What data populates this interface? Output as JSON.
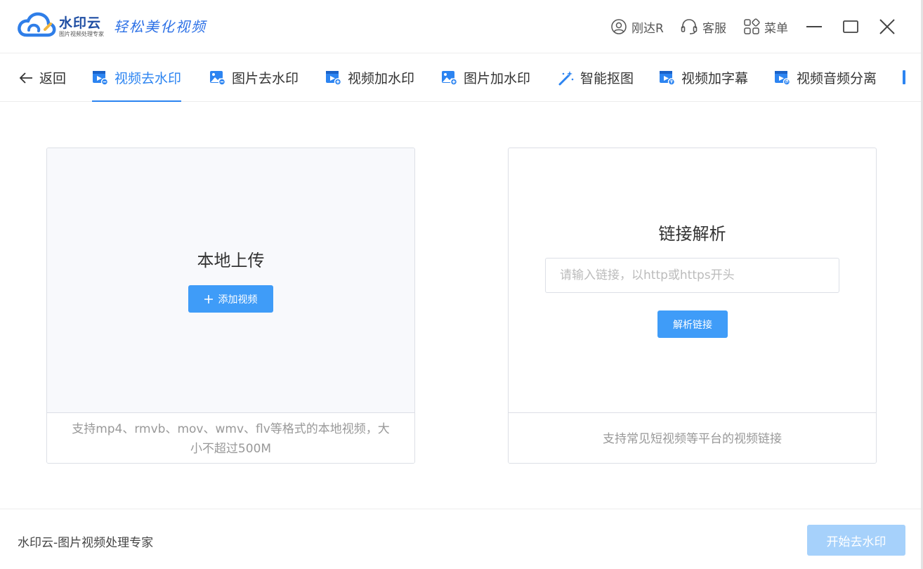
{
  "app": {
    "brand_name": "水印云",
    "brand_sub": "图片视频处理专家",
    "slogan": "轻松美化视频"
  },
  "titlebar": {
    "user_label": "刚达R",
    "support_label": "客服",
    "menu_label": "菜单"
  },
  "tabs": {
    "back_label": "返回",
    "items": [
      {
        "label": "视频去水印",
        "icon": "video-icon"
      },
      {
        "label": "图片去水印",
        "icon": "image-icon"
      },
      {
        "label": "视频加水印",
        "icon": "video-add-icon"
      },
      {
        "label": "图片加水印",
        "icon": "image-add-icon"
      },
      {
        "label": "智能抠图",
        "icon": "magic-wand-icon"
      },
      {
        "label": "视频加字幕",
        "icon": "video-subtitle-icon"
      },
      {
        "label": "视频音频分离",
        "icon": "video-audio-icon"
      }
    ],
    "active_index": 0
  },
  "upload_panel": {
    "title": "本地上传",
    "button_label": "添加视频",
    "hint": "支持mp4、rmvb、mov、wmv、flv等格式的本地视频，大小不超过500M"
  },
  "link_panel": {
    "title": "链接解析",
    "input_value": "",
    "input_placeholder": "请输入链接，以http或https开头",
    "button_label": "解析链接",
    "hint": "支持常见短视频等平台的视频链接"
  },
  "footer": {
    "text": "水印云-图片视频处理专家",
    "start_label": "开始去水印"
  },
  "colors": {
    "accent": "#2c84f1",
    "button": "#3f9cf8",
    "button_disabled": "#a6d1fb"
  }
}
